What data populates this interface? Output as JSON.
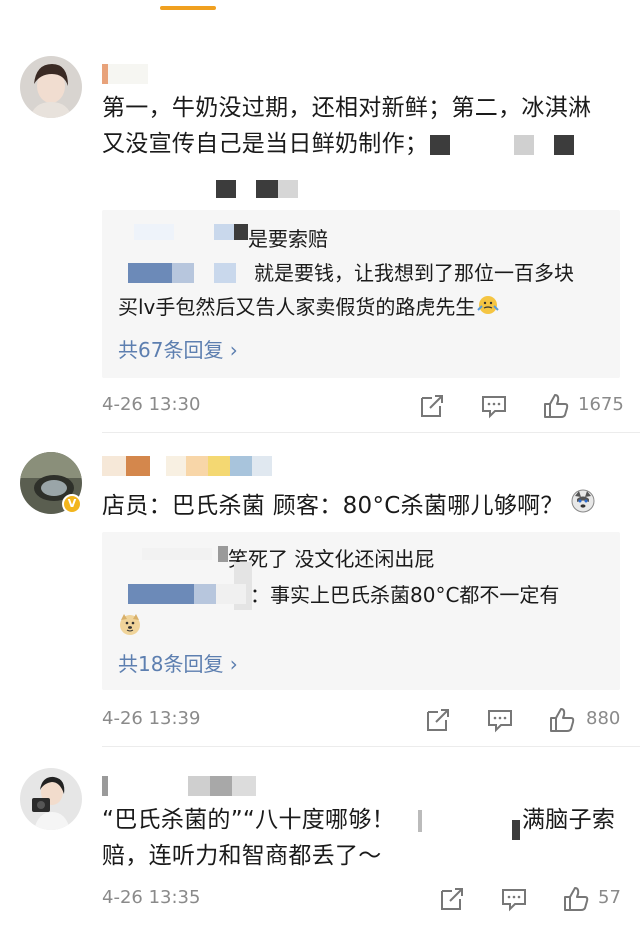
{
  "comments": [
    {
      "text_line1": "第一，牛奶没过期，还相对新鲜；第二，冰淇淋",
      "text_line2": "又没宣传自己是当日鲜奶制作；",
      "replies": [
        {
          "text": "是要索赔"
        },
        {
          "text": "就是要钱，让我想到了那位一百多块"
        },
        {
          "text": "买lv手包然后又告人家卖假货的路虎先生"
        }
      ],
      "reply_count": "共67条回复 ›",
      "time": "4-26 13:30",
      "likes": "1675"
    },
    {
      "text": "店员：巴氏杀菌 顾客：80°C杀菌哪儿够啊？",
      "replies": [
        {
          "text": "笑死了 没文化还闲出屁"
        },
        {
          "text": "：事实上巴氏杀菌80°C都不一定有"
        }
      ],
      "reply_count": "共18条回复 ›",
      "time": "4-26 13:39",
      "likes": "880"
    },
    {
      "text_line1_a": "“巴氏杀菌的”“八十度哪够！",
      "text_line1_b": "满脑子索",
      "text_line2": "赔，连听力和智商都丢了～",
      "time": "4-26 13:35",
      "likes": "57"
    }
  ],
  "icons": {
    "share": "share-icon",
    "comment": "comment-icon",
    "like": "thumbs-up-icon",
    "verified": "verified-badge-icon",
    "emoji_shrug": "emoji-shrug-icon",
    "emoji_husky": "emoji-husky-icon",
    "emoji_doge": "emoji-doge-icon"
  },
  "colors": {
    "link": "#5d7fb0",
    "time": "#8a8a8a",
    "reply_bg": "#f6f6f6",
    "accent": "#f0a020",
    "verified": "#f2b51e"
  }
}
